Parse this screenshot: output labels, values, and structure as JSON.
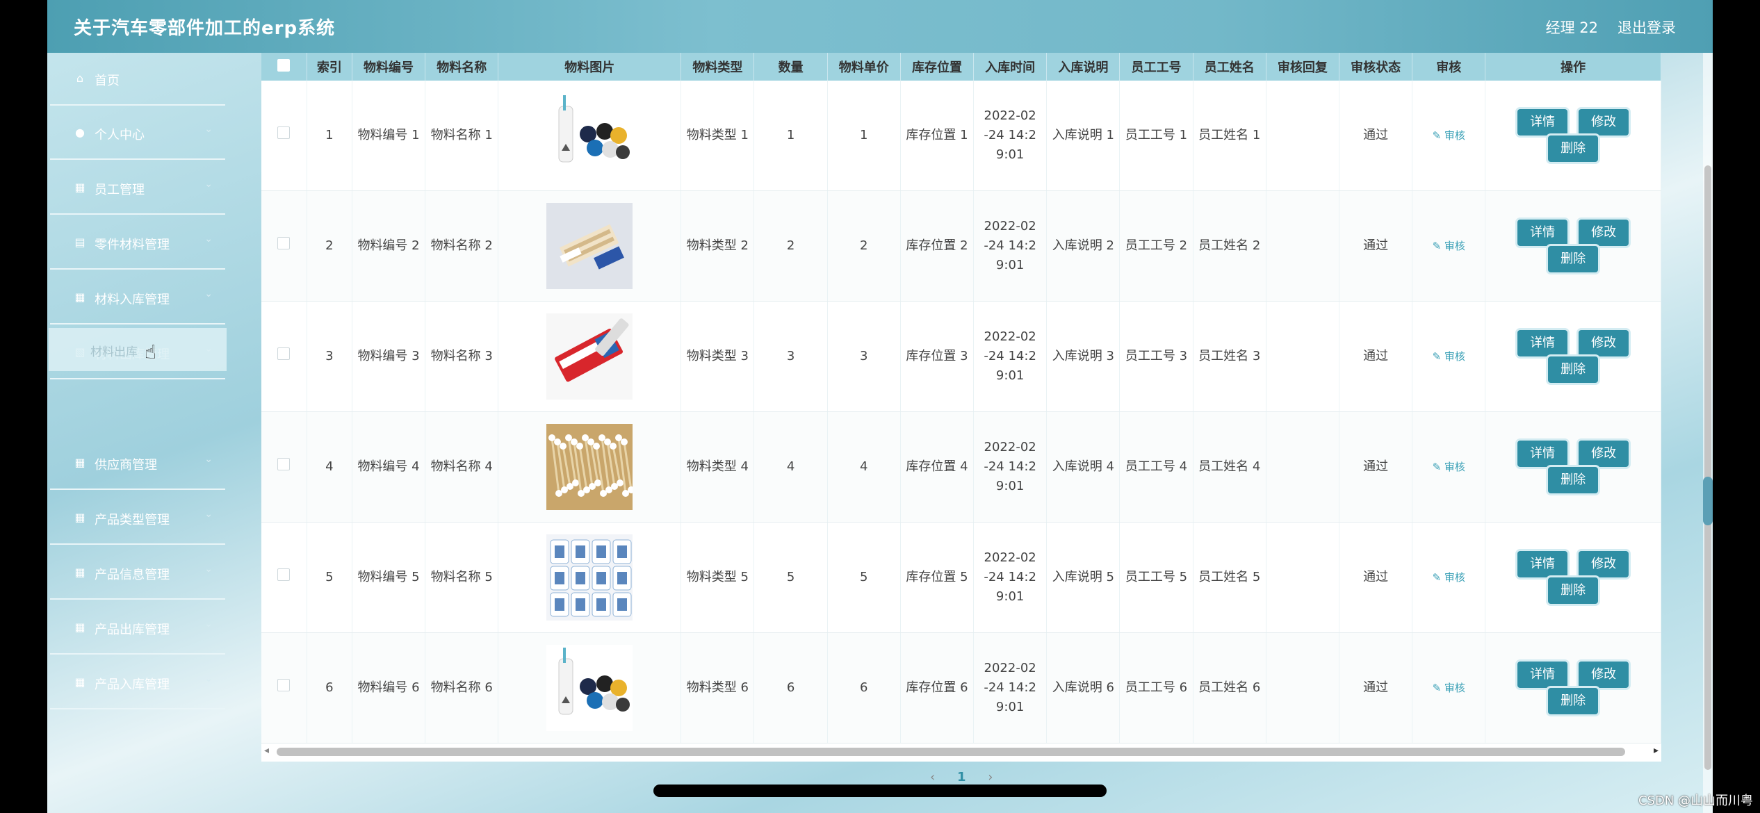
{
  "app": {
    "title": "关于汽车零部件加工的erp系统",
    "user": "经理 22",
    "logout": "退出登录"
  },
  "sidebar": {
    "items": [
      {
        "label": "首页",
        "icon": "home-icon",
        "glyph": "⌂",
        "arrow": ""
      },
      {
        "label": "个人中心",
        "icon": "user-icon",
        "glyph": "●",
        "arrow": "⌄"
      },
      {
        "label": "员工管理",
        "icon": "grid-icon",
        "glyph": "▦",
        "arrow": "⌄"
      },
      {
        "label": "零件材料管理",
        "icon": "clipboard-icon",
        "glyph": "▤",
        "arrow": "⌄"
      },
      {
        "label": "材料入库管理",
        "icon": "grid-icon",
        "glyph": "▦",
        "arrow": "⌄"
      },
      {
        "label": "材料出库管理",
        "icon": "stack-icon",
        "glyph": "▧",
        "arrow": "⌄"
      },
      {
        "label": "供应商管理",
        "icon": "grid-icon",
        "glyph": "▦",
        "arrow": "⌄"
      },
      {
        "label": "产品类型管理",
        "icon": "grid-icon",
        "glyph": "▦",
        "arrow": "⌄"
      },
      {
        "label": "产品信息管理",
        "icon": "grid-icon",
        "glyph": "▦",
        "arrow": "⌄"
      },
      {
        "label": "产品出库管理",
        "icon": "grid-icon",
        "glyph": "▦",
        "arrow": "⌄"
      },
      {
        "label": "产品入库管理",
        "icon": "grid-icon",
        "glyph": "▦",
        "arrow": "⌄"
      }
    ],
    "submenu_label": "材料出库"
  },
  "table": {
    "headers": [
      "",
      "索引",
      "物料编号",
      "物料名称",
      "物料图片",
      "物料类型",
      "数量",
      "物料单价",
      "库存位置",
      "入库时间",
      "入库说明",
      "员工工号",
      "员工姓名",
      "审核回复",
      "审核状态",
      "审核",
      "操作"
    ],
    "rows": [
      {
        "index": "1",
        "code": "物料编号 1",
        "name": "物料名称 1",
        "image": "cleaning-supplies",
        "type": "物料类型 1",
        "qty": "1",
        "price": "1",
        "location": "库存位置 1",
        "time": "2022-02 -24 14:2 9:01",
        "note": "入库说明 1",
        "emp_no": "员工工号 1",
        "emp_name": "员工姓名 1",
        "reply": "",
        "status": "通过",
        "audit": "审核"
      },
      {
        "index": "2",
        "code": "物料编号 2",
        "name": "物料名称 2",
        "image": "toothbrush-pack",
        "type": "物料类型 2",
        "qty": "2",
        "price": "2",
        "location": "库存位置 2",
        "time": "2022-02 -24 14:2 9:01",
        "note": "入库说明 2",
        "emp_no": "员工工号 2",
        "emp_name": "员工姓名 2",
        "reply": "",
        "status": "通过",
        "audit": "审核"
      },
      {
        "index": "3",
        "code": "物料编号 3",
        "name": "物料名称 3",
        "image": "toothpaste",
        "type": "物料类型 3",
        "qty": "3",
        "price": "3",
        "location": "库存位置 3",
        "time": "2022-02 -24 14:2 9:01",
        "note": "入库说明 3",
        "emp_no": "员工工号 3",
        "emp_name": "员工姓名 3",
        "reply": "",
        "status": "通过",
        "audit": "审核"
      },
      {
        "index": "4",
        "code": "物料编号 4",
        "name": "物料名称 4",
        "image": "cotton-swabs",
        "type": "物料类型 4",
        "qty": "4",
        "price": "4",
        "location": "库存位置 4",
        "time": "2022-02 -24 14:2 9:01",
        "note": "入库说明 4",
        "emp_no": "员工工号 4",
        "emp_name": "员工姓名 4",
        "reply": "",
        "status": "通过",
        "audit": "审核"
      },
      {
        "index": "5",
        "code": "物料编号 5",
        "name": "物料名称 5",
        "image": "tissue-rolls",
        "type": "物料类型 5",
        "qty": "5",
        "price": "5",
        "location": "库存位置 5",
        "time": "2022-02 -24 14:2 9:01",
        "note": "入库说明 5",
        "emp_no": "员工工号 5",
        "emp_name": "员工姓名 5",
        "reply": "",
        "status": "通过",
        "audit": "审核"
      },
      {
        "index": "6",
        "code": "物料编号 6",
        "name": "物料名称 6",
        "image": "cleaning-supplies",
        "type": "物料类型 6",
        "qty": "6",
        "price": "6",
        "location": "库存位置 6",
        "time": "2022-02 -24 14:2 9:01",
        "note": "入库说明 6",
        "emp_no": "员工工号 6",
        "emp_name": "员工姓名 6",
        "reply": "",
        "status": "通过",
        "audit": "审核"
      }
    ],
    "buttons": {
      "detail": "详情",
      "edit": "修改",
      "delete": "删除"
    }
  },
  "pagination": {
    "prev": "‹",
    "current": "1",
    "next": "›"
  },
  "watermark": "CSDN @山山而川粤",
  "colors": {
    "accent": "#2f8ea4",
    "header": "#9fd3df",
    "topbar": "#5aa9bb"
  }
}
